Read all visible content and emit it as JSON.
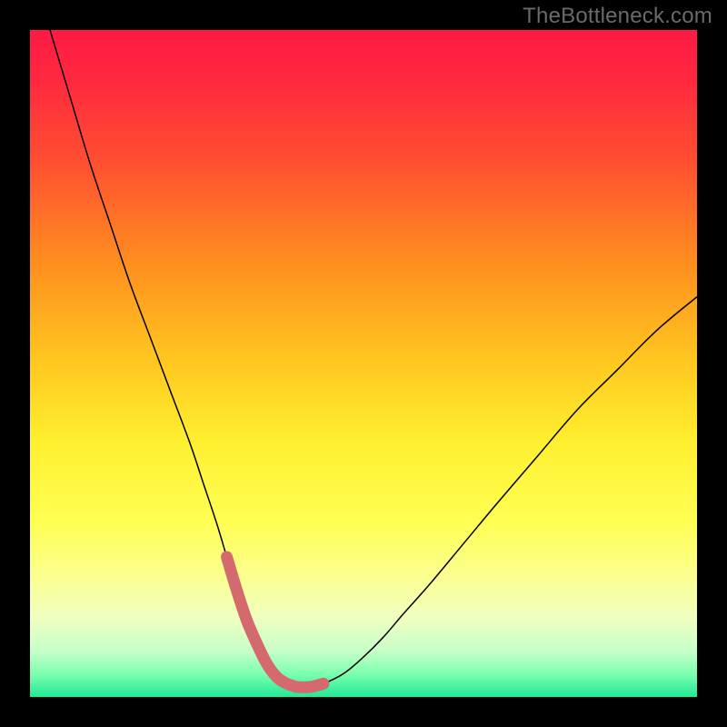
{
  "watermark": "TheBottleneck.com",
  "gradient": {
    "stops": [
      {
        "offset": 0.0,
        "color": "#ff1a44"
      },
      {
        "offset": 0.08,
        "color": "#ff2a3f"
      },
      {
        "offset": 0.2,
        "color": "#ff5030"
      },
      {
        "offset": 0.35,
        "color": "#ff8e1f"
      },
      {
        "offset": 0.5,
        "color": "#ffc820"
      },
      {
        "offset": 0.62,
        "color": "#fff030"
      },
      {
        "offset": 0.74,
        "color": "#ffff55"
      },
      {
        "offset": 0.82,
        "color": "#fbff90"
      },
      {
        "offset": 0.88,
        "color": "#f0ffc0"
      },
      {
        "offset": 0.93,
        "color": "#c8ffc8"
      },
      {
        "offset": 0.965,
        "color": "#7dffb0"
      },
      {
        "offset": 1.0,
        "color": "#20e995"
      }
    ]
  },
  "highlight_colors": {
    "left": "#d46a6e",
    "bottom": "#d46a6e",
    "right": "#d46a6e"
  },
  "chart_data": {
    "type": "line",
    "title": "",
    "xlabel": "",
    "ylabel": "",
    "xlim": [
      0,
      100
    ],
    "ylim": [
      0,
      100
    ],
    "grid": false,
    "legend": false,
    "series": [
      {
        "name": "curve",
        "x": [
          3,
          6,
          9,
          12,
          15,
          18,
          21,
          24,
          26,
          28,
          29.5,
          31,
          32.5,
          34,
          35.5,
          37,
          38.5,
          40,
          42,
          44,
          47,
          50,
          53,
          56,
          60,
          65,
          70,
          76,
          82,
          88,
          94,
          100
        ],
        "y": [
          100,
          90,
          80,
          71,
          62,
          54,
          46,
          38,
          32,
          26,
          21,
          16,
          11.5,
          8,
          5,
          3,
          2,
          1.5,
          1.5,
          2,
          3.5,
          6,
          9,
          12.5,
          17,
          23,
          29,
          36,
          43,
          49,
          55,
          60
        ]
      }
    ],
    "highlighted_x_range": [
      29.5,
      44
    ],
    "annotations": []
  }
}
